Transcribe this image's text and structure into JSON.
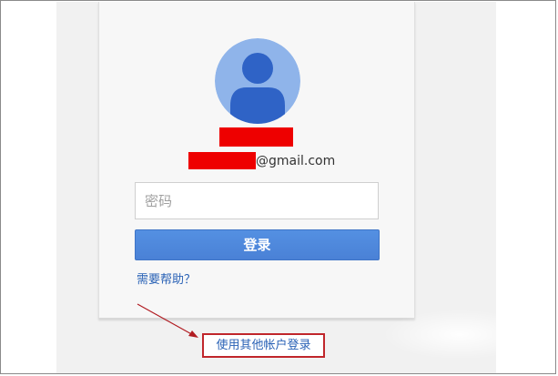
{
  "account": {
    "email_suffix": "@gmail.com"
  },
  "login_form": {
    "password_placeholder": "密码",
    "signin_label": "登录",
    "help_link": "需要帮助？"
  },
  "footer": {
    "other_account_link": "使用其他帐户登录"
  },
  "icons": {
    "avatar": "person-avatar-icon",
    "annotation_arrow": "arrow-annotation"
  },
  "colors": {
    "accent": "#4c85dc",
    "link": "#2a62b6",
    "redaction": "#ee0000",
    "annotation": "#c0262b",
    "avatar_bg": "#8fb4ea",
    "avatar_figure": "#2f63c6"
  }
}
